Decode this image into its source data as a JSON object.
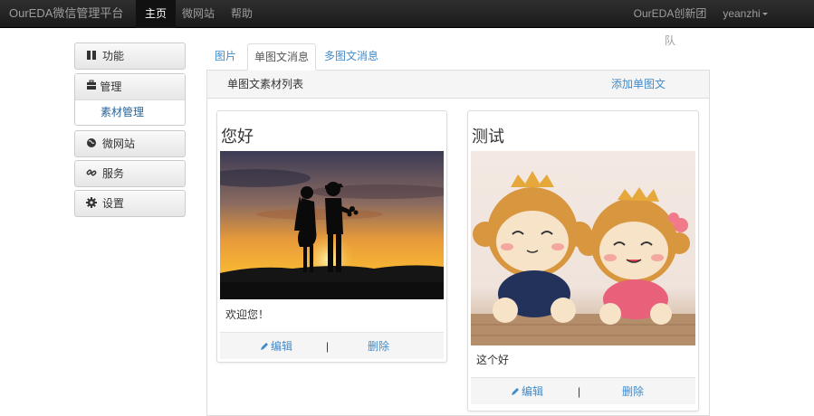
{
  "navbar": {
    "brand": "OurEDA微信管理平台",
    "items": [
      "主页",
      "微网站",
      "帮助"
    ],
    "team": "OurEDA创新团队",
    "user": "yeanzhi"
  },
  "sidebar": {
    "function": "功能",
    "manage": "管理",
    "manage_sub": "素材管理",
    "microsite": "微网站",
    "service": "服务",
    "settings": "设置"
  },
  "tabs": [
    "图片",
    "单图文消息",
    "多图文消息"
  ],
  "panel": {
    "title": "单图文素材列表",
    "add_link": "添加单图文"
  },
  "cards": [
    {
      "title": "您好",
      "desc": "欢迎您！",
      "edit": "编辑",
      "sep": "|",
      "delete": "删除"
    },
    {
      "title": "测试",
      "desc": "这个好",
      "edit": "编辑",
      "sep": "|",
      "delete": "删除"
    }
  ],
  "colors": {
    "link": "#428bca",
    "navbar": "#222222"
  }
}
